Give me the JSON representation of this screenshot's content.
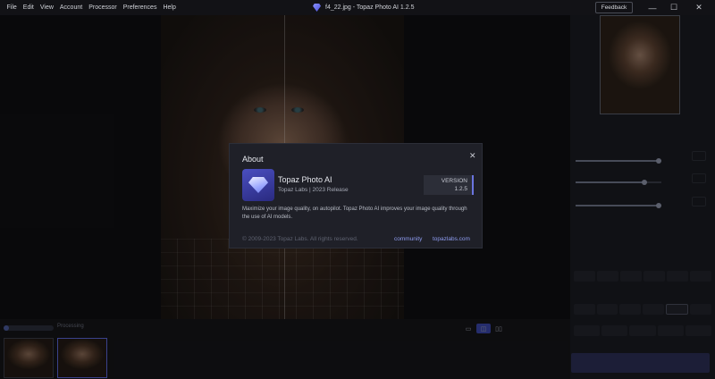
{
  "menu": [
    "File",
    "Edit",
    "View",
    "Account",
    "Processor",
    "Preferences",
    "Help"
  ],
  "window_title": "f4_22.jpg - Topaz Photo AI 1.2.5",
  "feedback_label": "Feedback",
  "window_controls": {
    "minimize": "—",
    "maximize": "☐",
    "close": "✕"
  },
  "right_panel": {
    "sliders": [
      {
        "label": "",
        "value": "",
        "level": 0.97
      },
      {
        "label": "",
        "value": "",
        "level": 0.8
      },
      {
        "label": "",
        "value": "",
        "level": 0.97
      }
    ],
    "upscale_section": "",
    "input_label": "",
    "output_label": "",
    "save_label": ""
  },
  "bottom": {
    "progress_label": "Processing",
    "progress_fraction": 0.1,
    "zoom": ""
  },
  "about": {
    "title": "About",
    "close": "✕",
    "app_name": "Topaz Photo AI",
    "subtitle": "Topaz Labs | 2023 Release",
    "version_label": "VERSION",
    "version": "1.2.5",
    "description": "Maximize your image quality, on autopilot. Topaz Photo AI improves your image quality through the use of AI models.",
    "copyright": "© 2009-2023 Topaz Labs. All rights reserved.",
    "link_community": "community",
    "link_site": "topazlabs.com"
  }
}
